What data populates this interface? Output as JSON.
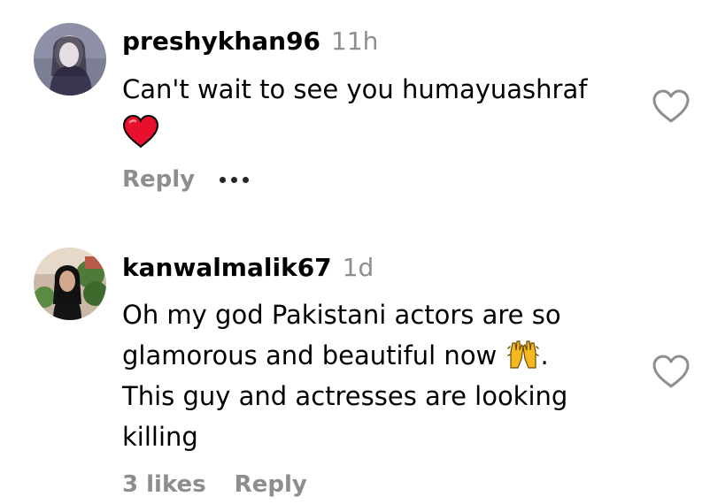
{
  "comments": [
    {
      "username": "preshykhan96",
      "timestamp": "11h",
      "text_lines": [
        "Can't wait to see you humayuashraf"
      ],
      "inline_emoji": "red-heart",
      "actions": {
        "reply": "Reply"
      },
      "more_icon": "more-horizontal-icon",
      "like_icon": "heart-outline-icon"
    },
    {
      "username": "kanwalmalik67",
      "timestamp": "1d",
      "text_lines": [
        "Oh my god Pakistani actors are so",
        "glamorous and beautiful now",
        "This guy and actresses are looking",
        "killing"
      ],
      "inline_emoji_after_line_2": "raising-hands",
      "line_2_suffix": ".",
      "actions": {
        "likes": "3 likes",
        "reply": "Reply"
      },
      "like_icon": "heart-outline-icon"
    }
  ],
  "colors": {
    "text": "#000000",
    "secondary": "#8e8e8e",
    "heart_red": "#e8112d"
  }
}
